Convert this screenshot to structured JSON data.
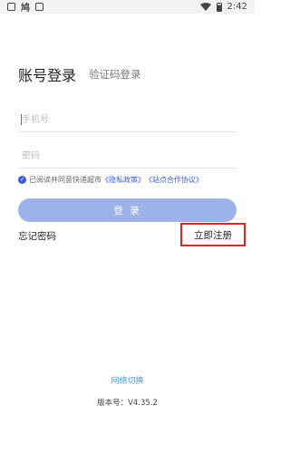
{
  "status_bar": {
    "app_label": "鸠",
    "time": "2:42"
  },
  "tabs": {
    "active": "账号登录",
    "inactive": "验证码登录"
  },
  "fields": {
    "phone_placeholder": "手机号",
    "password_placeholder": "密码"
  },
  "agreement": {
    "text": "已阅读并同意快递超市",
    "privacy_link": "《隐私政策》",
    "site_link": "《站点合作协议》"
  },
  "buttons": {
    "login": "登 录",
    "forgot": "忘记密码",
    "register": "立即注册",
    "network_switch": "网络切换"
  },
  "version": {
    "label": "版本号：",
    "value": "V4.35.2"
  },
  "colors": {
    "accent": "#3d5cd6",
    "login_button": "#9cb2e8",
    "highlight_border": "#e02424",
    "network_link": "#4a9ee8"
  }
}
